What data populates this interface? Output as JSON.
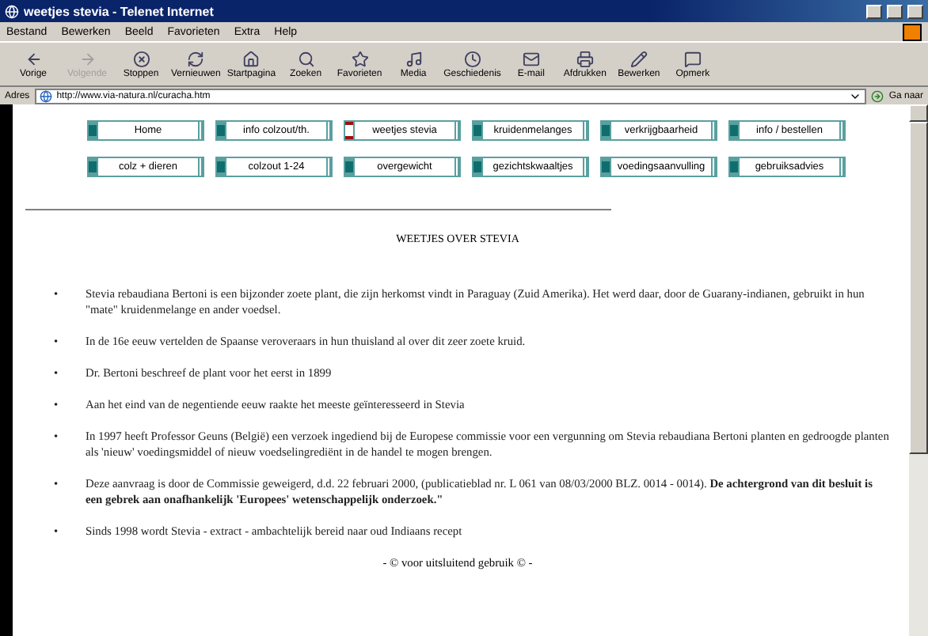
{
  "window": {
    "title": "weetjes stevia - Telenet Internet"
  },
  "menu": [
    "Bestand",
    "Bewerken",
    "Beeld",
    "Favorieten",
    "Extra",
    "Help"
  ],
  "toolbar": [
    {
      "label": "Vorige",
      "disabled": false
    },
    {
      "label": "Volgende",
      "disabled": true
    },
    {
      "label": "Stoppen",
      "disabled": false
    },
    {
      "label": "Vernieuwen",
      "disabled": false
    },
    {
      "label": "Startpagina",
      "disabled": false
    },
    {
      "label": "Zoeken",
      "disabled": false
    },
    {
      "label": "Favorieten",
      "disabled": false
    },
    {
      "label": "Media",
      "disabled": false
    },
    {
      "label": "Geschiedenis",
      "disabled": false
    },
    {
      "label": "E-mail",
      "disabled": false
    },
    {
      "label": "Afdrukken",
      "disabled": false
    },
    {
      "label": "Bewerken",
      "disabled": false
    },
    {
      "label": "Opmerk",
      "disabled": false
    }
  ],
  "address": {
    "label": "Adres",
    "url": "http://www.via-natura.nl/curacha.htm",
    "go": "Ga naar"
  },
  "nav": [
    [
      {
        "label": "Home",
        "selected": false
      },
      {
        "label": "info colzout/th.",
        "selected": false
      },
      {
        "label": "weetjes stevia",
        "selected": true
      },
      {
        "label": "kruidenmelanges",
        "selected": false
      },
      {
        "label": "verkrijgbaarheid",
        "selected": false
      },
      {
        "label": "info / bestellen",
        "selected": false
      }
    ],
    [
      {
        "label": "colz + dieren",
        "selected": false
      },
      {
        "label": "colzout 1-24",
        "selected": false
      },
      {
        "label": "overgewicht",
        "selected": false
      },
      {
        "label": "gezichtskwaaltjes",
        "selected": false
      },
      {
        "label": "voedingsaanvulling",
        "selected": false
      },
      {
        "label": "gebruiksadvies",
        "selected": false
      }
    ]
  ],
  "heading": "WEETJES OVER STEVIA",
  "bullet_marker": "•",
  "bullets": [
    "Stevia rebaudiana Bertoni is een bijzonder zoete plant, die zijn herkomst vindt in Paraguay (Zuid Amerika). Het werd daar, door de Guarany-indianen, gebruikt in hun \"mate\" kruidenmelange en ander voedsel.",
    "In de 16e eeuw vertelden de Spaanse veroveraars in hun thuisland al over dit zeer zoete kruid.",
    "Dr. Bertoni beschreef de plant voor het eerst in 1899",
    "Aan het eind van de negentiende eeuw raakte het meeste geïnteresseerd in Stevia",
    "In 1997 heeft Professor Geuns (België) een verzoek ingediend bij de Europese commissie voor een vergunning om Stevia rebaudiana Bertoni planten en gedroogde planten als 'nieuw' voedingsmiddel of nieuw voedselingrediënt in de handel te mogen brengen.",
    "Deze aanvraag is door de Commissie geweigerd, d.d. 22 februari 2000, (publicatieblad nr. L 061 van 08/03/2000 BLZ. 0014 - 0014). **De achtergrond van dit besluit is een gebrek aan onafhankelijk 'Europees' wetenschappelijk onderzoek.\"**",
    "Sinds 1998 wordt Stevia - extract - ambachtelijk bereid naar oud Indiaans recept"
  ],
  "footer": "- © voor uitsluitend gebruik © -"
}
